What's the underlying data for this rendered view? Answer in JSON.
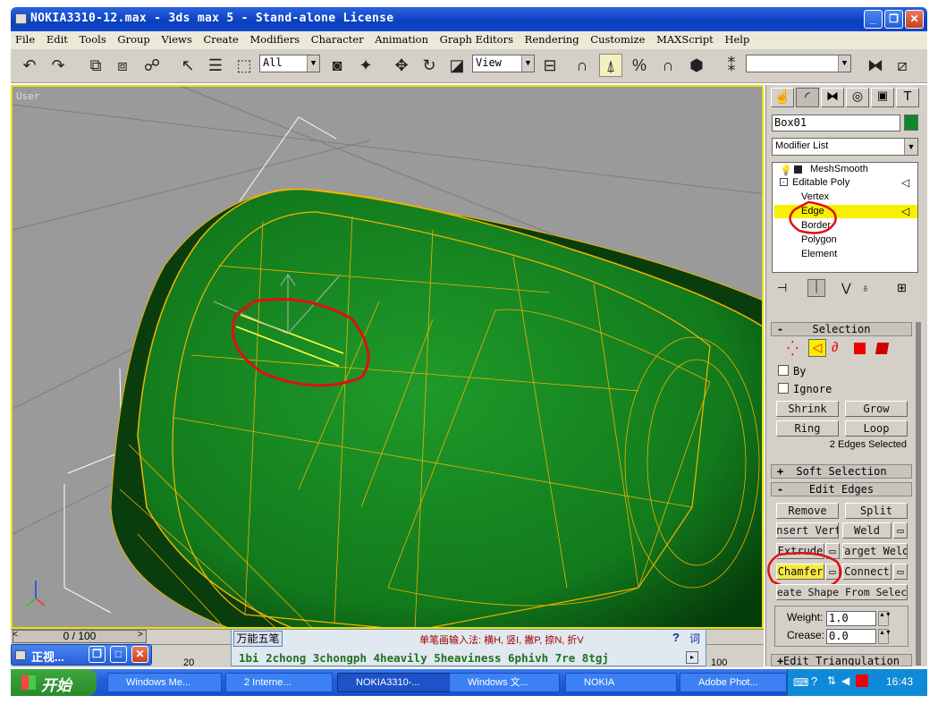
{
  "window": {
    "title": "NOKIA3310-12.max - 3ds max 5 - Stand-alone License"
  },
  "menu": [
    "File",
    "Edit",
    "Tools",
    "Group",
    "Views",
    "Create",
    "Modifiers",
    "Character",
    "Animation",
    "Graph Editors",
    "Rendering",
    "Customize",
    "MAXScript",
    "Help"
  ],
  "toolbar": {
    "selection_filter": "All",
    "ref_coord": "View"
  },
  "viewport": {
    "label": "User"
  },
  "panel": {
    "object_name": "Box01",
    "modifier_list": "Modifier List",
    "stack": {
      "meshsmooth": "MeshSmooth",
      "editable_poly": "Editable Poly",
      "vertex": "Vertex",
      "edge": "Edge",
      "border": "Border",
      "polygon": "Polygon",
      "element": "Element"
    },
    "selection": {
      "title": "Selection",
      "by": "By",
      "ignore": "Ignore",
      "shrink": "Shrink",
      "grow": "Grow",
      "ring": "Ring",
      "loop": "Loop",
      "status": "2 Edges Selected"
    },
    "soft_selection": "Soft Selection",
    "edit_edges": {
      "title": "Edit Edges",
      "remove": "Remove",
      "split": "Split",
      "insert_vertex": "Insert Vertex",
      "weld": "Weld",
      "extrude": "Extrude",
      "target_weld": "Target Weld",
      "chamfer": "Chamfer",
      "connect": "Connect",
      "create_shape": "Create Shape From Selection",
      "weight_label": "Weight:",
      "weight": "1.0",
      "crease_label": "Crease:",
      "crease": "0.0"
    },
    "collapsed_rollout": "Edit Triangulation"
  },
  "timeline": {
    "frame": "0 / 100",
    "tick": "20",
    "tick_end": "100"
  },
  "ime": {
    "name": "万能五笔",
    "mode": "单笔画输入法: 横H, 竖I, 撇P, 捺N, 折V",
    "help": "?",
    "word": "词",
    "candidates": "1bi 2chong 3chongph 4heavily 5heaviness 6phivh 7re 8tgj"
  },
  "mini_window": {
    "title": "正视..."
  },
  "taskbar": {
    "start": "开始",
    "items": [
      "Windows Me...",
      "2 Interne...",
      "NOKIA3310-...",
      "Windows 文...",
      "NOKIA",
      "Adobe Phot..."
    ],
    "clock": "16:43"
  }
}
